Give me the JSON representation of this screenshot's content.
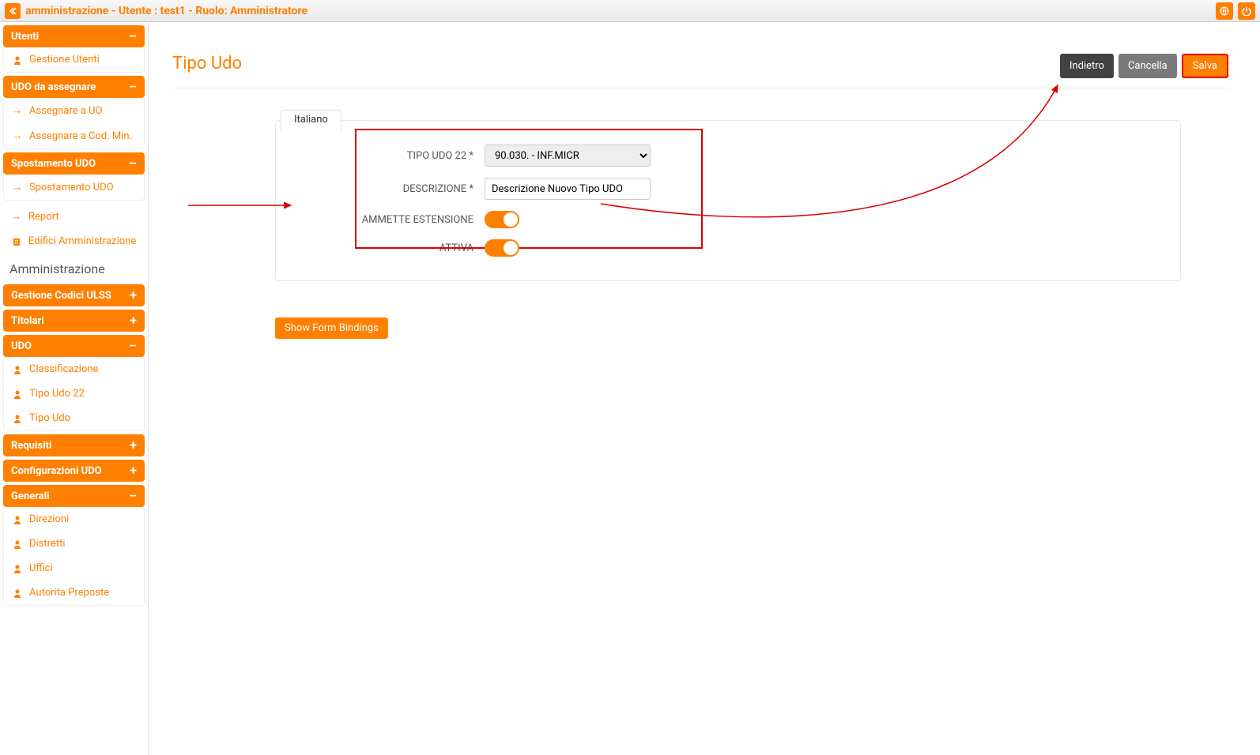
{
  "topbar": {
    "title": "amministrazione - Utente : test1 - Ruolo: Amministratore"
  },
  "sidebar": {
    "panels": [
      {
        "title": "Utenti",
        "toggle": "–",
        "items": [
          {
            "icon": "user",
            "label": "Gestione Utenti"
          }
        ]
      },
      {
        "title": "UDO da assegnare",
        "toggle": "–",
        "items": [
          {
            "icon": "arrow",
            "label": "Assegnare a UO"
          },
          {
            "icon": "arrow",
            "label": "Assegnare a Cod. Min."
          }
        ]
      },
      {
        "title": "Spostamento UDO",
        "toggle": "–",
        "items": [
          {
            "icon": "arrow",
            "label": "Spostamento UDO"
          }
        ]
      }
    ],
    "loose_items": [
      {
        "icon": "arrow",
        "label": "Report"
      },
      {
        "icon": "building",
        "label": "Edifici Amministrazione"
      }
    ],
    "section_title": "Amministrazione",
    "admin_panels": [
      {
        "title": "Gestione Codici ULSS",
        "toggle": "+",
        "items": []
      },
      {
        "title": "Titolari",
        "toggle": "+",
        "items": []
      },
      {
        "title": "UDO",
        "toggle": "–",
        "items": [
          {
            "icon": "user",
            "label": "Classificazione"
          },
          {
            "icon": "user",
            "label": "Tipo Udo 22"
          },
          {
            "icon": "user",
            "label": "Tipo Udo"
          }
        ]
      },
      {
        "title": "Requisiti",
        "toggle": "+",
        "items": []
      },
      {
        "title": "Configurazioni UDO",
        "toggle": "+",
        "items": []
      },
      {
        "title": "Generali",
        "toggle": "–",
        "items": [
          {
            "icon": "user",
            "label": "Direzioni"
          },
          {
            "icon": "user",
            "label": "Distretti"
          },
          {
            "icon": "user",
            "label": "Uffici"
          },
          {
            "icon": "user",
            "label": "Autorita Preposte"
          }
        ]
      }
    ]
  },
  "page": {
    "title": "Tipo Udo",
    "actions": {
      "back": "Indietro",
      "cancel": "Cancella",
      "save": "Salva"
    },
    "lang_tab": "Italiano",
    "form": {
      "field1_label": "TIPO UDO 22 *",
      "field1_value": "90.030. - INF.MICR",
      "field2_label": "DESCRIZIONE *",
      "field2_value": "Descrizione Nuovo Tipo UDO",
      "field3_label": "AMMETTE ESTENSIONE",
      "field4_label": "ATTIVA"
    },
    "debug_button": "Show Form Bindings"
  }
}
